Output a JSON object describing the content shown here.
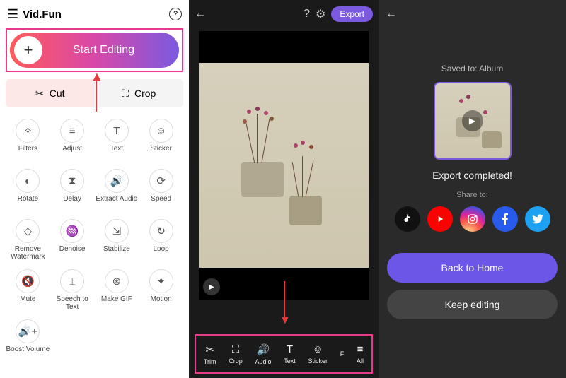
{
  "panel1": {
    "app_title": "Vid.Fun",
    "start_label": "Start Editing",
    "cut_label": "Cut",
    "crop_label": "Crop",
    "tools": [
      {
        "label": "Filters",
        "icon": "✧"
      },
      {
        "label": "Adjust",
        "icon": "≡"
      },
      {
        "label": "Text",
        "icon": "T"
      },
      {
        "label": "Sticker",
        "icon": "☺"
      },
      {
        "label": "Rotate",
        "icon": "◐"
      },
      {
        "label": "Delay",
        "icon": "⧗"
      },
      {
        "label": "Extract Audio",
        "icon": "🔊"
      },
      {
        "label": "Speed",
        "icon": "⟳"
      },
      {
        "label": "Remove Watermark",
        "icon": "◇"
      },
      {
        "label": "Denoise",
        "icon": "♒"
      },
      {
        "label": "Stabilize",
        "icon": "⇲"
      },
      {
        "label": "Loop",
        "icon": "↻"
      },
      {
        "label": "Mute",
        "icon": "🔇"
      },
      {
        "label": "Speech to Text",
        "icon": "⌶"
      },
      {
        "label": "Make GIF",
        "icon": "⊛"
      },
      {
        "label": "Motion",
        "icon": "✦"
      },
      {
        "label": "Boost Volume",
        "icon": "🔊+"
      }
    ]
  },
  "panel2": {
    "export_label": "Export",
    "editbar": [
      {
        "label": "Trim",
        "icon": "✂"
      },
      {
        "label": "Crop",
        "icon": "⛶"
      },
      {
        "label": "Audio",
        "icon": "🔊"
      },
      {
        "label": "Text",
        "icon": "T"
      },
      {
        "label": "Sticker",
        "icon": "☺"
      },
      {
        "label": "F",
        "icon": ""
      },
      {
        "label": "All",
        "icon": "≡"
      }
    ]
  },
  "panel3": {
    "saved_to": "Saved to: Album",
    "export_done": "Export completed!",
    "share_to": "Share to:",
    "back_home": "Back to Home",
    "keep_editing": "Keep editing"
  }
}
